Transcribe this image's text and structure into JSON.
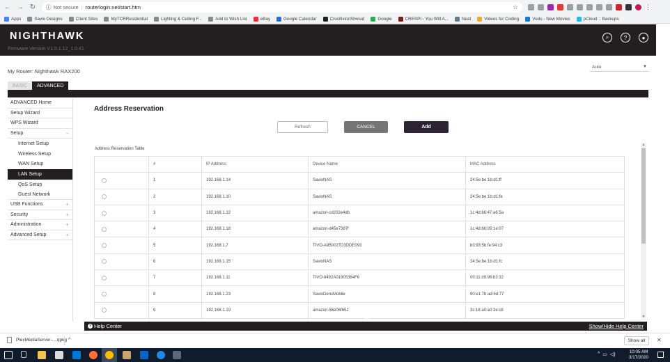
{
  "browser": {
    "url_security": "Not secure",
    "url": "routerlogin.net/start.htm",
    "bookmarks": [
      "Apps",
      "Savio Designs",
      "Client Sites",
      "MyTCRResidential",
      "Lighting & Ceiling F...",
      "Add to Wish List",
      "eBay",
      "Google Calendar",
      "CrucifixionShroud",
      "Google",
      "CRESPI - You Will A...",
      "Neat",
      "Videos for Coding",
      "Vudu - New Movies",
      "pCloud :: Backups"
    ]
  },
  "header": {
    "logo": "NIGHTHAWK",
    "firmware": "Firmware Version V1.0.1.12_1.0.41"
  },
  "router_label": "My Router: Nighthawk RAX200",
  "language_select": {
    "value": "Auto"
  },
  "tabs": [
    {
      "label": "BASIC"
    },
    {
      "label": "ADVANCED"
    }
  ],
  "sidebar": {
    "items": [
      {
        "label": "ADVANCED Home"
      },
      {
        "label": "Setup Wizard"
      },
      {
        "label": "WPS Wizard"
      },
      {
        "label": "Setup",
        "expander": "−"
      },
      {
        "label": "Internet Setup"
      },
      {
        "label": "Wireless Setup"
      },
      {
        "label": "WAN Setup"
      },
      {
        "label": "LAN Setup"
      },
      {
        "label": "QoS Setup"
      },
      {
        "label": "Guest Network"
      },
      {
        "label": "USB Functions",
        "expander": "+"
      },
      {
        "label": "Security",
        "expander": "+"
      },
      {
        "label": "Administration",
        "expander": "+"
      },
      {
        "label": "Advanced Setup",
        "expander": "+"
      }
    ]
  },
  "main": {
    "title": "Address Reservation",
    "buttons": {
      "refresh": "Refresh",
      "cancel": "CANCEL",
      "add": "Add"
    },
    "table_caption": "Address Reservation Table",
    "columns": [
      "",
      "#",
      "IP Address",
      "Device Name",
      "MAC Address"
    ],
    "rows": [
      {
        "num": "1",
        "ip": "192.168.1.14",
        "device": "SavioNAS",
        "mac": "24:5e:be:1b:d1:ff"
      },
      {
        "num": "2",
        "ip": "192.168.1.10",
        "device": "SavioNAS",
        "mac": "24:5e:be:1b:d1:fe"
      },
      {
        "num": "3",
        "ip": "192.168.1.22",
        "device": "amazon-cd202e4db",
        "mac": "1c:4d:66:47:a6:5a"
      },
      {
        "num": "4",
        "ip": "192.168.1.18",
        "device": "amazon-d45e7387f",
        "mac": "1c:4d:66:05:1e:07"
      },
      {
        "num": "5",
        "ip": "192.168.1.7",
        "device": "TIVO-A950027D3DDE093",
        "mac": "b0:93:5b:fe:94:c3"
      },
      {
        "num": "6",
        "ip": "192.168.1.15",
        "device": "SavioNAS",
        "mac": "24:5e:be:1b:d1:fc"
      },
      {
        "num": "7",
        "ip": "192.168.1.11",
        "device": "TIVO-8492A01905384F6",
        "mac": "00:11:d9:98:b3:32"
      },
      {
        "num": "8",
        "ip": "192.168.1.23",
        "device": "SavioDensMobile",
        "mac": "90:e1:7b:ad:5d:77"
      },
      {
        "num": "9",
        "ip": "192.168.1.19",
        "device": "amazon-58e06f652",
        "mac": "3c:18:a0:a0:3e:c8"
      }
    ]
  },
  "help": {
    "label": "Help Center",
    "toggle": "Show/Hide Help Center"
  },
  "downloads": {
    "file": "PlexMediaServer-....qpkg",
    "show_all": "Show all"
  },
  "taskbar": {
    "time": "10:05 AM",
    "date": "3/17/2020"
  },
  "colors": {
    "header_bg": "#231f20",
    "add_button": "#2c2432",
    "cancel_button": "#757575",
    "taskbar_bg": "#101b2b"
  }
}
